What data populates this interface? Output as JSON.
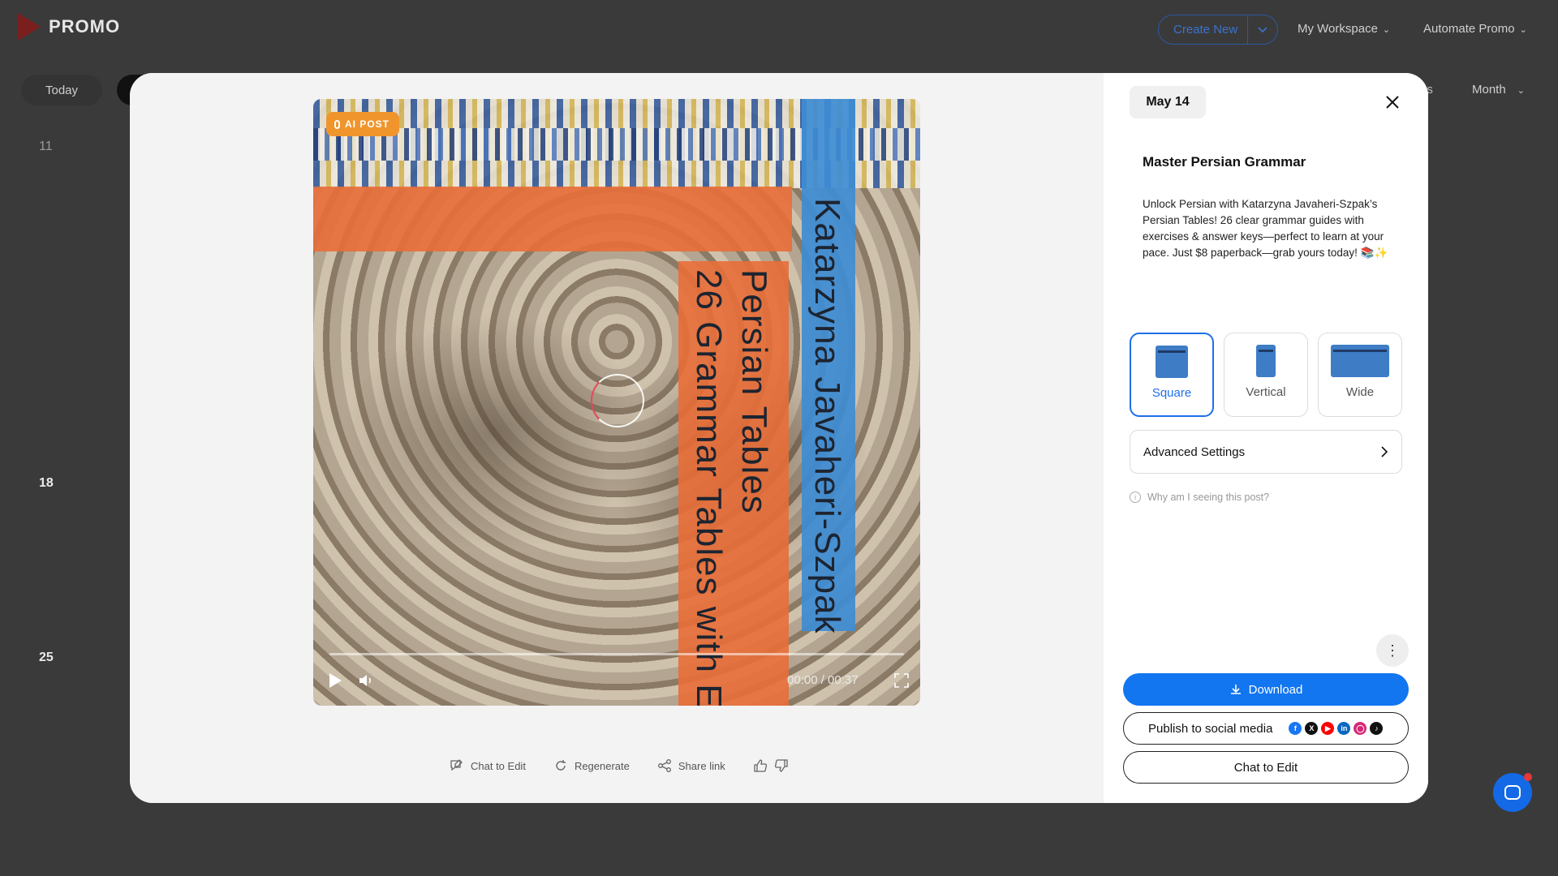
{
  "app": {
    "brand": "PROMO",
    "nav": {
      "create_new": "Create New",
      "workspace": "My Workspace",
      "automate": "Automate Promo"
    },
    "calendar": {
      "today": "Today",
      "filters": "ers",
      "view": "Month",
      "weeks": [
        "11",
        "18",
        "25"
      ]
    }
  },
  "modal": {
    "date": "May 14",
    "badge": "AI POST",
    "video": {
      "author_text": "Katarzyna Javaheri-Szpak",
      "title_line1": "Persian Tables",
      "title_line2": "26 Grammar Tables with E",
      "time": "00:00 / 00:37",
      "progress": 0
    },
    "actions": {
      "chat_to_edit": "Chat to Edit",
      "regenerate": "Regenerate",
      "share_link": "Share link"
    },
    "post": {
      "title": "Master Persian Grammar",
      "body": "Unlock Persian with Katarzyna Javaheri-Szpak’s Persian Tables! 26 clear grammar guides with exercises & answer keys—perfect to learn at your pace. Just $8 paperback—grab yours today! 📚✨"
    },
    "formats": [
      {
        "label": "Square",
        "active": true
      },
      {
        "label": "Vertical",
        "active": false
      },
      {
        "label": "Wide",
        "active": false
      }
    ],
    "advanced_settings": "Advanced Settings",
    "why_text": "Why am I seeing this post?",
    "buttons": {
      "download": "Download",
      "publish": "Publish to social media",
      "chat_to_edit": "Chat to Edit"
    },
    "social_icons": [
      "facebook-icon",
      "x-icon",
      "youtube-icon",
      "linkedin-icon",
      "instagram-icon",
      "tiktok-icon"
    ],
    "colors": {
      "accent": "#1176f0",
      "badge": "#f0952c",
      "overlay_orange": "#e86e38",
      "overlay_blue": "#3e8cd4"
    }
  }
}
